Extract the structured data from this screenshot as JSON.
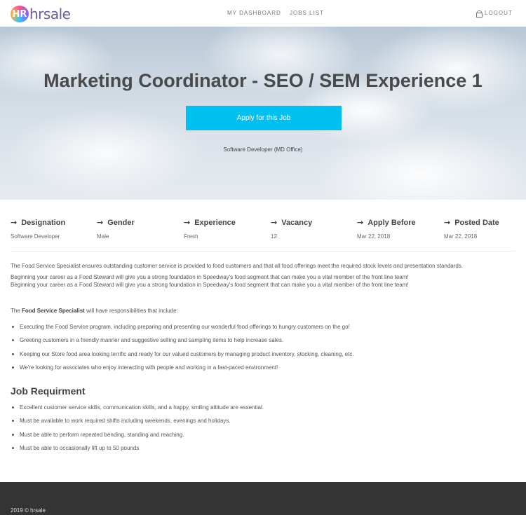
{
  "header": {
    "logo_mark": "HR",
    "logo_text": "hrsale",
    "nav": {
      "dashboard": "MY DASHBOARD",
      "jobs_list": "JOBS LIST",
      "logout": "LOGOUT"
    }
  },
  "hero": {
    "title": "Marketing Coordinator - SEO / SEM Experience 1",
    "apply_button": "Apply for this Job",
    "subtitle": "Software Developer (MD Office)"
  },
  "info": [
    {
      "label": "Designation",
      "value": "Software Developer"
    },
    {
      "label": "Gender",
      "value": "Male"
    },
    {
      "label": "Experience",
      "value": "Fresh"
    },
    {
      "label": "Vacancy",
      "value": "12"
    },
    {
      "label": "Apply Before",
      "value": "Mar 22, 2018"
    },
    {
      "label": "Posted Date",
      "value": "Mar 22, 2018"
    }
  ],
  "description": {
    "intro": "The Food Service Specialist ensures outstanding customer service is provided to food customers and that all food offerings meet the required stock levels and presentation standards.",
    "career_line": "Beginning your career as a Food Steward will give you a strong foundation in Speedway's food segment that can make you a vital member of the front line team!",
    "lead_prefix": "The ",
    "lead_bold": "Food Service Specialist",
    "lead_suffix": " will have responsibilities that include:",
    "responsibilities": [
      "Executing the Food Service program, including preparing and presenting our wonderful food offerings to hungry customers on the go!",
      "Greeting customers in a friendly manner and suggestive selling and sampling items to help increase sales.",
      "Keeping our Store food area looking terrific and ready for our valued customers by managing product inventory, stocking, cleaning, etc.",
      "We're looking for associates who enjoy interacting with people and working in a fast-paced environment!"
    ]
  },
  "requirements": {
    "title": "Job Requirment",
    "items": [
      "Excellent customer service skills, communication skills, and a happy, smiling attitude are essential.",
      "Must be available to work required shifts including weekends, evenings and holidays.",
      "Must be able to perform repeated bending, standing and reaching.",
      "Must be able to occasionally lift up to 50 pounds"
    ]
  },
  "footer": {
    "copyright": "2019 © hrsale"
  },
  "colors": {
    "accent": "#00c0ef",
    "footer_bg": "#343434"
  }
}
